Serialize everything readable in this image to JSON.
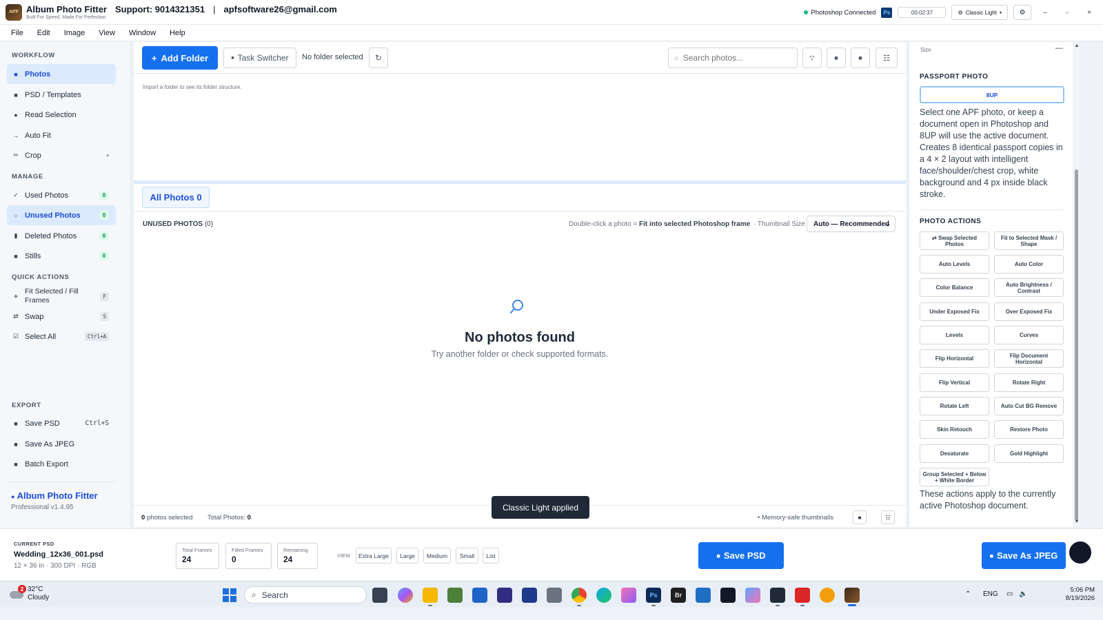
{
  "titlebar": {
    "logo_text": "APF",
    "app_title": "Album Photo Fitter",
    "app_tagline": "Built For Speed, Made For Perfection",
    "support": "Support: 9014321351",
    "separator": "|",
    "email": "apfsoftware26@gmail.com",
    "ps_status": "Photoshop Connected",
    "ps_badge": "Ps",
    "timer": "00:02:37",
    "theme": "Classic Light"
  },
  "menu": [
    "File",
    "Edit",
    "Image",
    "View",
    "Window",
    "Help"
  ],
  "sidebar": {
    "workflow_title": "WORKFLOW",
    "workflow": [
      {
        "label": "Photos",
        "icon": "square-icon"
      },
      {
        "label": "PSD / Templates",
        "icon": "square-icon"
      },
      {
        "label": "Read Selection",
        "icon": "dot-icon"
      },
      {
        "label": "Auto Fit",
        "icon": "arrow-right-icon"
      },
      {
        "label": "Crop",
        "icon": "scissors-icon"
      }
    ],
    "manage_title": "MANAGE",
    "manage": [
      {
        "label": "Used Photos",
        "count": "0"
      },
      {
        "label": "Unused Photos",
        "count": "0"
      },
      {
        "label": "Deleted Photos",
        "count": "0"
      },
      {
        "label": "Stills",
        "count": "0"
      }
    ],
    "quick_title": "QUICK ACTIONS",
    "quick": [
      {
        "label": "Fit Selected / Fill Frames",
        "kbd": "F"
      },
      {
        "label": "Swap",
        "kbd": "S"
      },
      {
        "label": "Select All",
        "kbd": "Ctrl+A"
      }
    ],
    "export_title": "EXPORT",
    "export": [
      {
        "label": "Save PSD",
        "kbd": "Ctrl+S"
      },
      {
        "label": "Save As JPEG",
        "kbd": ""
      },
      {
        "label": "Batch Export",
        "kbd": ""
      }
    ],
    "brand": "Album Photo Fitter",
    "version": "Professional v1.4.95"
  },
  "toolbar": {
    "add_folder": "Add Folder",
    "task_switcher": "Task Switcher",
    "folder_status": "No folder selected",
    "search_placeholder": "Search photos..."
  },
  "folder_tree": {
    "hint": "Import a folder to see its folder structure."
  },
  "photos": {
    "tab_all": "All Photos 0",
    "section_title": "UNUSED PHOTOS",
    "section_count": "(0)",
    "dblclick_prefix": "Double-click a photo =",
    "dblclick_action": "Fit into selected Photoshop frame",
    "thumb_label": "· Thumbnail Size",
    "thumb_value": "Auto — Recommended",
    "empty_title": "No photos found",
    "empty_sub": "Try another folder or check supported formats."
  },
  "status": {
    "selected_count": "0",
    "selected_label": "photos selected",
    "total_label": "Total Photos:",
    "total_value": "0",
    "memory": "• Memory-safe thumbnails"
  },
  "toast": "Classic Light applied",
  "right_panel": {
    "size_label": "Size",
    "passport_title": "PASSPORT PHOTO",
    "btn_8up": "8UP",
    "passport_desc": "Select one APF photo, or keep a document open in Photoshop and 8UP will use the active document. Creates 8 identical passport copies in a 4 × 2 layout with intelligent face/shoulder/chest crop, white background and 4 px inside black stroke.",
    "actions_title": "PHOTO ACTIONS",
    "actions": [
      "⇄ Swap Selected Photos",
      "Fit to Selected Mask / Shape",
      "Auto Levels",
      "Auto Color",
      "Color Balance",
      "Auto Brightness / Contrast",
      "Under Exposed Fix",
      "Over Exposed Fix",
      "Levels",
      "Curves",
      "Flip Horizontal",
      "Flip Document Horizontal",
      "Flip Vertical",
      "Rotate Right",
      "Rotate Left",
      "Auto Cut BG Remove",
      "Skin Retouch",
      "Restore Photo",
      "Desaturate",
      "Gold Highlight",
      "Group Selected + Below + White Border"
    ],
    "footer": "These actions apply to the currently active Photoshop document."
  },
  "bottom": {
    "current_label": "CURRENT PSD",
    "file_name": "Wedding_12x36_001.psd",
    "file_meta": "12 × 36 in · 300 DPI · RGB",
    "stats": [
      {
        "label": "Total Frames",
        "value": "24"
      },
      {
        "label": "Filled Frames",
        "value": "0"
      },
      {
        "label": "Remaining",
        "value": "24"
      }
    ],
    "view_label": "VIEW",
    "views": [
      "Extra Large",
      "Large",
      "Medium",
      "Small",
      "List"
    ],
    "save_psd": "Save PSD",
    "save_jpeg": "Save As JPEG"
  },
  "taskbar": {
    "weather_temp": "32°C",
    "weather_desc": "Cloudy",
    "weather_badge": "2",
    "search": "Search",
    "lang": "ENG",
    "time": "5:06 PM",
    "date": "8/19/2026"
  }
}
